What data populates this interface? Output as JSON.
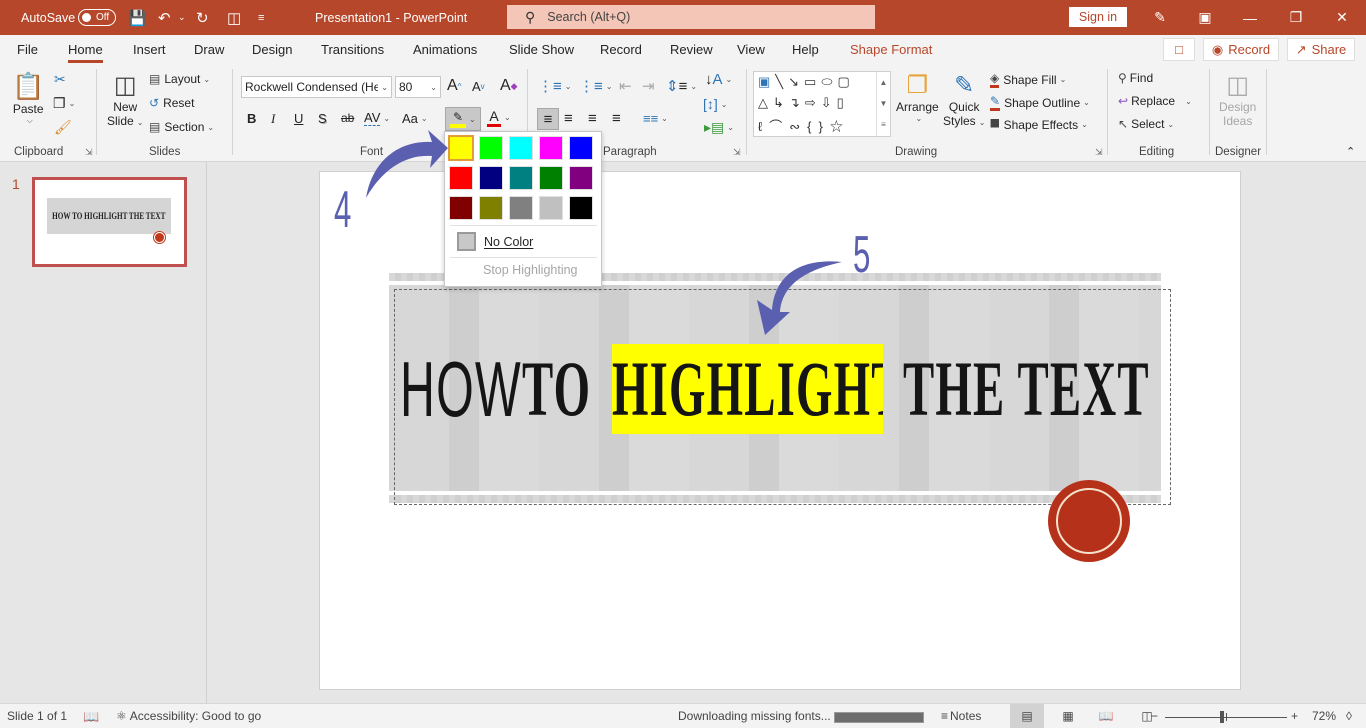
{
  "titlebar": {
    "autosave_label": "AutoSave",
    "autosave_state": "Off",
    "doc_title": "Presentation1  -  PowerPoint",
    "search_placeholder": "Search (Alt+Q)",
    "signin_label": "Sign in",
    "icons": [
      "save-icon",
      "undo-icon",
      "redo-icon",
      "present-icon",
      "customize-icon",
      "pen-icon",
      "ribbon-display-icon",
      "minimize-icon",
      "restore-icon",
      "close-icon"
    ]
  },
  "menu": {
    "tabs": [
      "File",
      "Home",
      "Insert",
      "Draw",
      "Design",
      "Transitions",
      "Animations",
      "Slide Show",
      "Record",
      "Review",
      "View",
      "Help",
      "Shape Format"
    ],
    "active_tab": "Home",
    "record_label": "Record",
    "share_label": "Share"
  },
  "ribbon": {
    "clipboard": {
      "label": "Clipboard",
      "paste": "Paste"
    },
    "slides": {
      "label": "Slides",
      "new_slide_line1": "New",
      "new_slide_line2": "Slide",
      "layout": "Layout",
      "reset": "Reset",
      "section": "Section"
    },
    "font": {
      "label": "Font",
      "font_name": "Rockwell Condensed (Hea",
      "font_size": "80",
      "bold": "B",
      "italic": "I",
      "underline": "U",
      "shadow": "S",
      "strike": "ab",
      "spacing": "AV",
      "case": "Aa"
    },
    "paragraph": {
      "label": "Paragraph"
    },
    "drawing": {
      "label": "Drawing",
      "arrange": "Arrange",
      "quick_styles_line1": "Quick",
      "quick_styles_line2": "Styles",
      "shape_fill": "Shape Fill",
      "shape_outline": "Shape Outline",
      "shape_effects": "Shape Effects"
    },
    "editing": {
      "label": "Editing",
      "find": "Find",
      "replace": "Replace",
      "select": "Select"
    },
    "designer": {
      "label": "Designer",
      "design_ideas_line1": "Design",
      "design_ideas_line2": "Ideas"
    }
  },
  "highlight_menu": {
    "colors": [
      "#ffff00",
      "#00ff00",
      "#00ffff",
      "#ff00ff",
      "#0000ff",
      "#ff0000",
      "#000080",
      "#008080",
      "#008000",
      "#800080",
      "#800000",
      "#808000",
      "#808080",
      "#c0c0c0",
      "#000000"
    ],
    "color_names": [
      "Yellow",
      "Bright Green",
      "Turquoise",
      "Pink",
      "Blue",
      "Red",
      "Dark Blue",
      "Teal",
      "Green",
      "Violet",
      "Dark Red",
      "Dark Yellow",
      "Gray-50%",
      "Gray-25%",
      "Black"
    ],
    "selected": "Yellow",
    "no_color": "No Color",
    "stop_highlighting": "Stop Highlighting"
  },
  "slides_pane": {
    "slide_number": "1",
    "thumb_text": "HOW TO HIGHLIGHT THE TEXT"
  },
  "slide": {
    "word1": "HOW",
    "word2": "TO",
    "highlighted": "HIGHLIGHT",
    "rest": "THE TEXT",
    "highlight_color": "#ffff00",
    "annotation_4": "4",
    "annotation_5": "5",
    "annotation_color": "#5b5fb0",
    "seal_color": "#b5311a"
  },
  "statusbar": {
    "slide_info": "Slide 1 of 1",
    "accessibility": "Accessibility: Good to go",
    "downloading": "Downloading missing fonts...",
    "download_progress": 1.0,
    "notes": "Notes",
    "zoom_minus": "−",
    "zoom_plus": "+",
    "zoom_level": "72%"
  },
  "colors": {
    "accent": "#b7472a"
  }
}
